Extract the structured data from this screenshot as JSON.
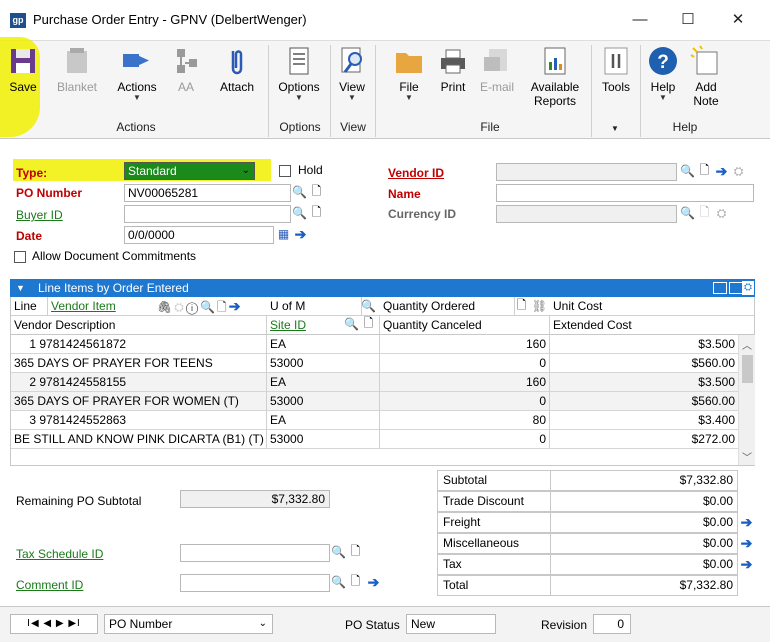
{
  "window": {
    "title": "Purchase Order Entry  -  GPNV (DelbertWenger)",
    "app_icon": "gp",
    "min": "—",
    "max": "☐",
    "close": "✕"
  },
  "ribbon": {
    "buttons": {
      "save": "Save",
      "blanket": "Blanket",
      "actions": "Actions",
      "aa": "AA",
      "attach": "Attach",
      "options": "Options",
      "view": "View",
      "file": "File",
      "print": "Print",
      "email": "E-mail",
      "available_reports": "Available Reports",
      "tools": "Tools",
      "help": "Help",
      "add_note": "Add Note"
    },
    "groups": {
      "actions": "Actions",
      "options": "Options",
      "view": "View",
      "file": "File",
      "help": "Help"
    },
    "highlight_color": "#f0f000"
  },
  "header": {
    "type_label": "Type:",
    "type_value": "Standard",
    "hold_label": "Hold",
    "po_number_label": "PO Number",
    "po_number_value": "NV00065281",
    "buyer_id_label": "Buyer ID",
    "buyer_id_value": "",
    "date_label": "Date",
    "date_value": "0/0/0000",
    "allow_commitments_label": "Allow Document Commitments",
    "vendor_id_label": "Vendor ID",
    "vendor_id_value": "",
    "name_label": "Name",
    "name_value": "",
    "currency_id_label": "Currency ID",
    "currency_id_value": ""
  },
  "grid": {
    "title": "Line Items by Order Entered",
    "headers": {
      "line": "Line",
      "vendor_item": "Vendor Item",
      "u_of_m": "U of M",
      "quantity_ordered": "Quantity Ordered",
      "unit_cost": "Unit Cost",
      "vendor_description": "Vendor Description",
      "site_id": "Site ID",
      "quantity_canceled": "Quantity Canceled",
      "extended_cost": "Extended Cost"
    },
    "rows": [
      {
        "line": "1",
        "item": "9781424561872",
        "uom": "EA",
        "qty": "160",
        "cost": "$3.500",
        "desc": "365 DAYS OF PRAYER FOR TEENS",
        "site": "53000",
        "canceled": "0",
        "ext": "$560.00"
      },
      {
        "line": "2",
        "item": "9781424558155",
        "uom": "EA",
        "qty": "160",
        "cost": "$3.500",
        "desc": "365 DAYS OF PRAYER FOR WOMEN (T)",
        "site": "53000",
        "canceled": "0",
        "ext": "$560.00"
      },
      {
        "line": "3",
        "item": "9781424552863",
        "uom": "EA",
        "qty": "80",
        "cost": "$3.400",
        "desc": "BE STILL AND KNOW PINK DICARTA (B1) (T)",
        "site": "53000",
        "canceled": "0",
        "ext": "$272.00"
      }
    ],
    "header_color": "#1e78d0"
  },
  "summary": {
    "remaining_label": "Remaining PO Subtotal",
    "remaining_value": "$7,332.80",
    "tax_schedule_label": "Tax Schedule ID",
    "tax_schedule_value": "",
    "comment_id_label": "Comment ID",
    "comment_id_value": "",
    "totals": {
      "subtotal_label": "Subtotal",
      "subtotal": "$7,332.80",
      "trade_discount_label": "Trade Discount",
      "trade_discount": "$0.00",
      "freight_label": "Freight",
      "freight": "$0.00",
      "misc_label": "Miscellaneous",
      "misc": "$0.00",
      "tax_label": "Tax",
      "tax": "$0.00",
      "total_label": "Total",
      "total": "$7,332.80"
    }
  },
  "footer": {
    "nav": "I◀  ◀  ▶  ▶I",
    "sort_value": "PO Number",
    "po_status_label": "PO Status",
    "po_status_value": "New",
    "revision_label": "Revision",
    "revision_value": "0"
  }
}
